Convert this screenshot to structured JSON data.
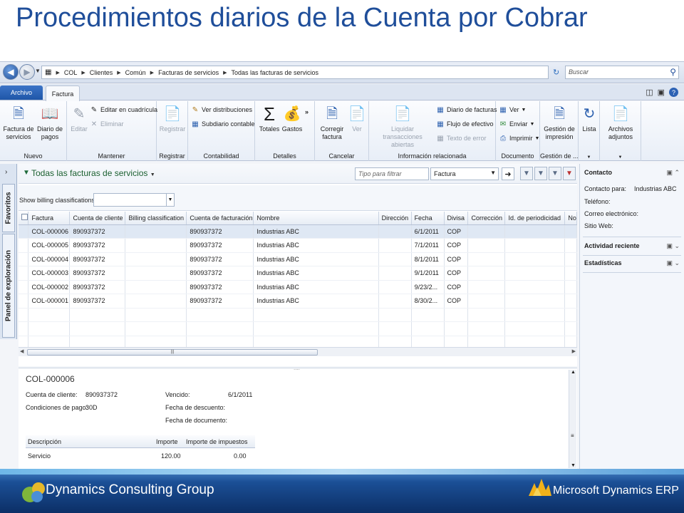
{
  "slide": {
    "title": "Procedimientos diarios de la Cuenta por  Cobrar"
  },
  "address": {
    "breadcrumbs": [
      "COL",
      "Clientes",
      "Común",
      "Facturas de servicios",
      "Todas las facturas de servicios"
    ],
    "search_placeholder": "Buscar"
  },
  "tabs": {
    "archivo": "Archivo",
    "factura": "Factura"
  },
  "ribbon": {
    "nuevo": {
      "label": "Nuevo",
      "factura_servicios": "Factura de servicios",
      "diario_pagos": "Diario de pagos"
    },
    "mantener": {
      "label": "Mantener",
      "editar": "Editar",
      "editar_cuadricula": "Editar en cuadrícula",
      "eliminar": "Eliminar"
    },
    "registrar": {
      "label": "Registrar",
      "registrar": "Registrar"
    },
    "contabilidad": {
      "label": "Contabilidad",
      "ver_distribuciones": "Ver distribuciones",
      "subdiario_contable": "Subdiario contable"
    },
    "detalles": {
      "label": "Detalles",
      "totales": "Totales",
      "gastos": "Gastos"
    },
    "cancelar": {
      "label": "Cancelar",
      "corregir_factura": "Corregir factura",
      "ver": "Ver"
    },
    "info": {
      "label": "Información relacionada",
      "liquidar": "Liquidar transacciones abiertas",
      "diario_facturas": "Diario de facturas",
      "flujo_efectivo": "Flujo de efectivo",
      "texto_error": "Texto de error"
    },
    "documento": {
      "label": "Documento",
      "ver": "Ver",
      "enviar": "Enviar",
      "imprimir": "Imprimir"
    },
    "gestion": {
      "label": "Gestión de ...",
      "gestion_impresion": "Gestión de impresión"
    },
    "lista": {
      "label": "Lista"
    },
    "archivos": {
      "label": "Archivos adjuntos"
    }
  },
  "leftpane": {
    "favoritos": "Favoritos",
    "panel": "Panel de exploración"
  },
  "list": {
    "title": "Todas las facturas de servicios",
    "filter_placeholder": "Tipo para filtrar",
    "filter_field": "Factura",
    "billing_label": "Show billing classifications:",
    "columns": [
      "Factura",
      "Cuenta de cliente",
      "Billing classification",
      "Cuenta de facturación",
      "Nombre",
      "Dirección",
      "Fecha",
      "Divisa",
      "Corrección",
      "Id. de periodicidad",
      "No"
    ],
    "rows": [
      [
        "COL-000006",
        "890937372",
        "",
        "890937372",
        "Industrias ABC",
        "",
        "6/1/2011",
        "COP",
        "",
        "",
        ""
      ],
      [
        "COL-000005",
        "890937372",
        "",
        "890937372",
        "Industrias ABC",
        "",
        "7/1/2011",
        "COP",
        "",
        "",
        ""
      ],
      [
        "COL-000004",
        "890937372",
        "",
        "890937372",
        "Industrias ABC",
        "",
        "8/1/2011",
        "COP",
        "",
        "",
        ""
      ],
      [
        "COL-000003",
        "890937372",
        "",
        "890937372",
        "Industrias ABC",
        "",
        "9/1/2011",
        "COP",
        "",
        "",
        ""
      ],
      [
        "COL-000002",
        "890937372",
        "",
        "890937372",
        "Industrias ABC",
        "",
        "9/23/2...",
        "COP",
        "",
        "",
        ""
      ],
      [
        "COL-000001",
        "890937372",
        "",
        "890937372",
        "Industrias ABC",
        "",
        "8/30/2...",
        "COP",
        "",
        "",
        ""
      ]
    ]
  },
  "factbox": {
    "contacto": "Contacto",
    "contacto_para_label": "Contacto para:",
    "contacto_para_value": "Industrias ABC",
    "telefono": "Teléfono:",
    "correo": "Correo electrónico:",
    "sitio": "Sitio Web:",
    "actividad": "Actividad reciente",
    "estadisticas": "Estadísticas"
  },
  "preview": {
    "title": "COL-000006",
    "cuenta_label": "Cuenta de cliente:",
    "cuenta_value": "890937372",
    "condiciones_label": "Condiciones de pago:",
    "condiciones_value": "30D",
    "vencido_label": "Vencido:",
    "vencido_value": "6/1/2011",
    "descuento_label": "Fecha de descuento:",
    "documento_label": "Fecha de documento:",
    "columns": [
      "Descripción",
      "Importe",
      "Importe de impuestos"
    ],
    "lines": [
      [
        "Servicio",
        "120.00",
        "0.00"
      ]
    ]
  },
  "footer": {
    "company": "Dynamics Consulting Group",
    "product": "Microsoft Dynamics ERP"
  }
}
